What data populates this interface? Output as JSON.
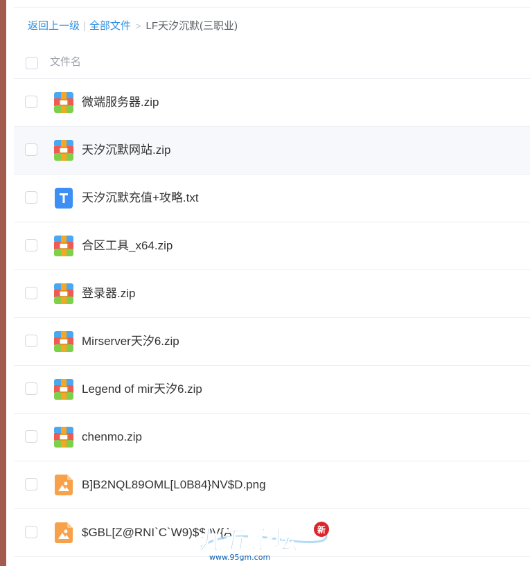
{
  "breadcrumb": {
    "back": "返回上一级",
    "sep": "|",
    "all_files": "全部文件",
    "arrow": ">",
    "current": "LF天汐沉默(三职业)"
  },
  "header": {
    "column_name": "文件名"
  },
  "files": [
    {
      "name": "微端服务器.zip",
      "type": "zip-icon"
    },
    {
      "name": "天汐沉默网站.zip",
      "type": "zip-icon"
    },
    {
      "name": "天汐沉默充值+攻略.txt",
      "type": "txt-icon"
    },
    {
      "name": "合区工具_x64.zip",
      "type": "zip-icon"
    },
    {
      "name": "登录器.zip",
      "type": "zip-icon"
    },
    {
      "name": "Mirserver天汐6.zip",
      "type": "zip-icon"
    },
    {
      "name": "Legend of mir天汐6.zip",
      "type": "zip-icon"
    },
    {
      "name": "chenmo.zip",
      "type": "zip-icon"
    },
    {
      "name": "B]B2NQL89OML[L0B84}NV$D.png",
      "type": "image-icon"
    },
    {
      "name": "$GBL[Z@RNI`C`W9)$$0V{A",
      "type": "image-icon"
    }
  ],
  "watermark": {
    "title": "九五论坛",
    "url": "www.95gm.com",
    "badge": "新"
  },
  "colors": {
    "link": "#2f8fe0",
    "left_bar": "#a35b4d",
    "hover_row": "#f6f8fb"
  }
}
